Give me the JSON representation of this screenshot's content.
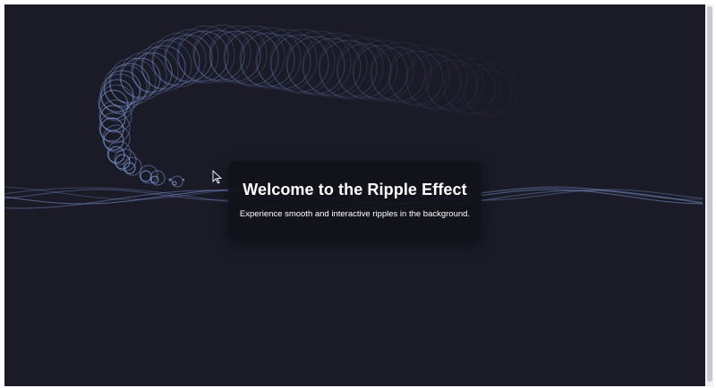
{
  "hero": {
    "title": "Welcome to the Ripple Effect",
    "subtitle": "Experience smooth and interactive ripples in the background."
  },
  "colors": {
    "background": "#1b1b28",
    "ripple": "#7f9cd8",
    "card": "#11111a",
    "text": "#ffffff"
  },
  "icons": {
    "cursor": "mouse-pointer-icon"
  }
}
